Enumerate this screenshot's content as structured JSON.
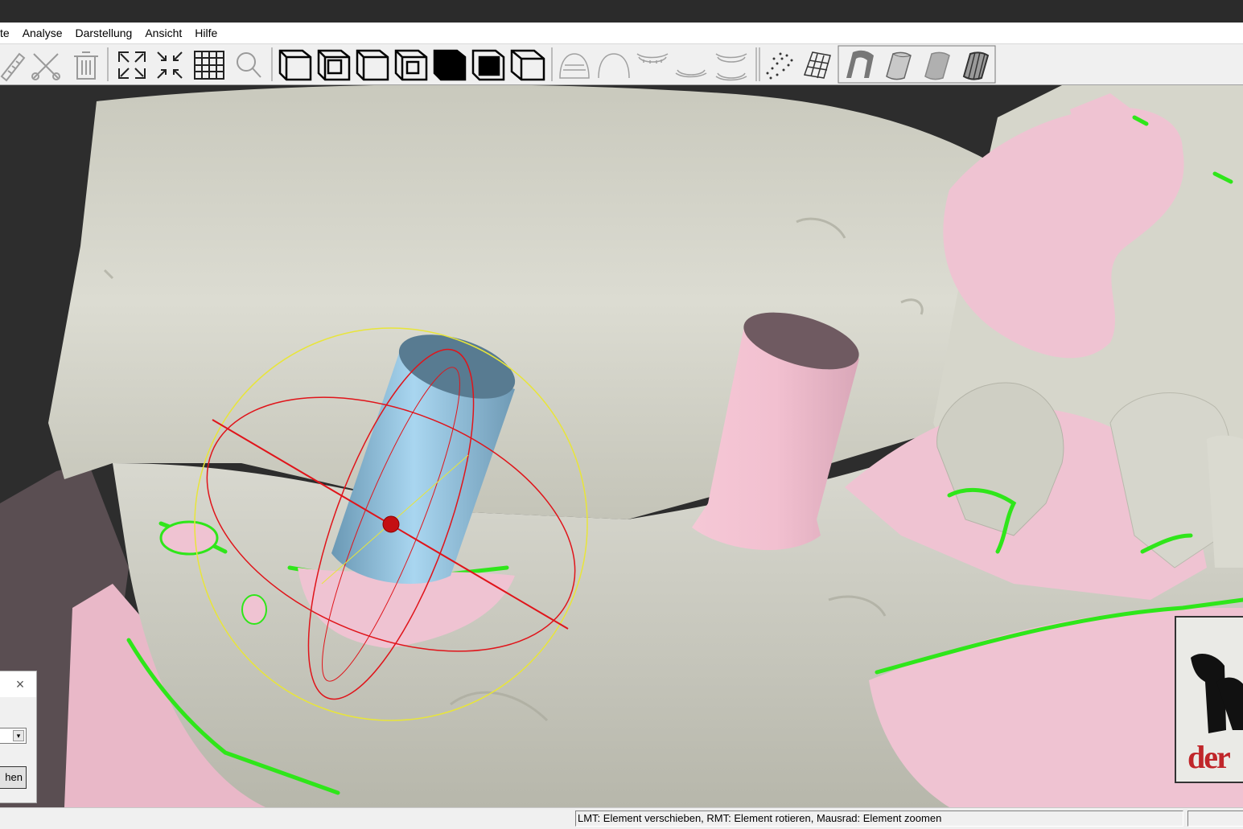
{
  "menu": {
    "items": [
      "te",
      "Analyse",
      "Darstellung",
      "Ansicht",
      "Hilfe"
    ]
  },
  "toolbar": {
    "groups": [
      [
        "measure-ruler-icon",
        "cut-icon",
        "delete-trash-icon"
      ],
      [
        "zoom-extents-icon",
        "zoom-in-icon",
        "grid-icon",
        "magnifier-icon"
      ],
      [
        "view-front-icon",
        "view-back-icon",
        "view-left-icon",
        "view-right-icon",
        "view-top-icon",
        "view-bottom-icon",
        "view-iso-icon"
      ],
      [
        "jaw-upper-icon",
        "arch-icon",
        "teeth-upper-icon",
        "teeth-lower-icon",
        "teeth-both-icon"
      ],
      [
        "pointcloud-icon",
        "wireframe-cylinder-icon",
        "abutment-icon",
        "cylinder-icon",
        "cylinder-shaded-icon",
        "cylinder-wire-icon"
      ]
    ]
  },
  "dialog": {
    "close_glyph": "×",
    "select_arrow": "▾",
    "button_label": "hen"
  },
  "logo": {
    "text": "der"
  },
  "statusbar": {
    "hint": "LMT: Element verschieben, RMT: Element rotieren, Mausrad: Element zoomen",
    "second": ""
  },
  "colors": {
    "model_gray": "#d2d2c6",
    "gingiva_pink": "#efc3d2",
    "margin_green": "#2fe61a",
    "implant_blue": "#8fc4e2",
    "gizmo_red": "#e0141a",
    "gizmo_yellow": "#e8e53a"
  }
}
